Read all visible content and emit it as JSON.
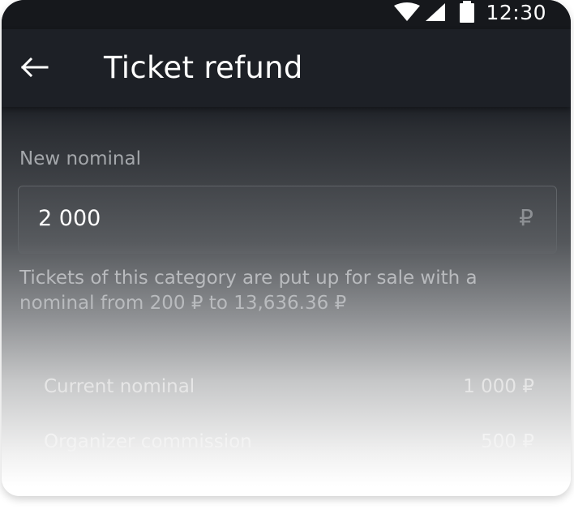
{
  "status_bar": {
    "time": "12:30",
    "icons": [
      "wifi-icon",
      "signal-icon",
      "battery-icon"
    ]
  },
  "app_bar": {
    "back_icon": "arrow-left-icon",
    "title": "Ticket refund"
  },
  "form": {
    "label": "New nominal",
    "value": "2 000",
    "currency_symbol": "₽",
    "helper_text": "Tickets of this category are put up for sale with a nominal from 200 ₽ to 13,636.36 ₽"
  },
  "summary": [
    {
      "label": "Current nominal",
      "value": "1 000 ₽"
    },
    {
      "label": "Organizer commission",
      "value": "500 ₽"
    }
  ],
  "colors": {
    "bar": "#1d2026",
    "text_primary": "#ffffff",
    "text_secondary": "#a4a7ab"
  }
}
